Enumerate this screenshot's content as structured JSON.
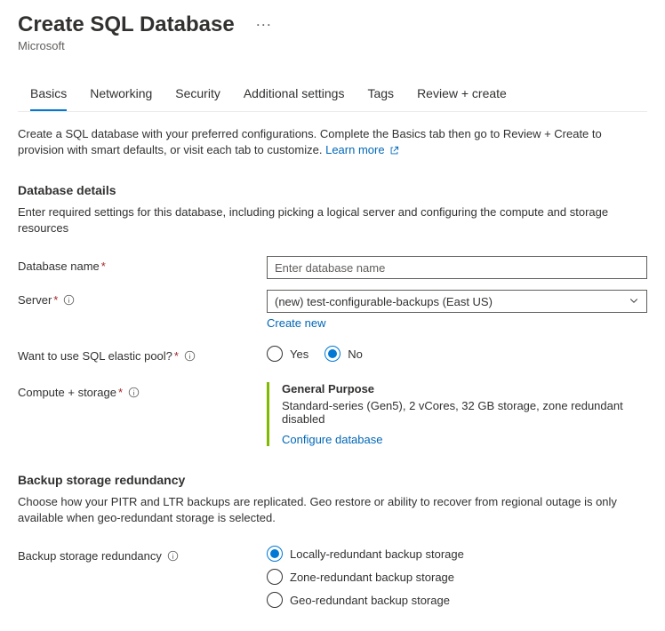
{
  "header": {
    "title": "Create SQL Database",
    "subtitle": "Microsoft"
  },
  "tabs": {
    "items": [
      {
        "label": "Basics",
        "active": true
      },
      {
        "label": "Networking",
        "active": false
      },
      {
        "label": "Security",
        "active": false
      },
      {
        "label": "Additional settings",
        "active": false
      },
      {
        "label": "Tags",
        "active": false
      },
      {
        "label": "Review + create",
        "active": false
      }
    ]
  },
  "intro": {
    "text": "Create a SQL database with your preferred configurations. Complete the Basics tab then go to Review + Create to provision with smart defaults, or visit each tab to customize. ",
    "learn_more": "Learn more"
  },
  "db_details": {
    "title": "Database details",
    "desc": "Enter required settings for this database, including picking a logical server and configuring the compute and storage resources",
    "name_label": "Database name",
    "name_placeholder": "Enter database name",
    "server_label": "Server",
    "server_value": "(new) test-configurable-backups (East US)",
    "create_new": "Create new",
    "elastic_label": "Want to use SQL elastic pool?",
    "elastic_yes": "Yes",
    "elastic_no": "No",
    "compute_label": "Compute + storage",
    "compute_title": "General Purpose",
    "compute_desc": "Standard-series (Gen5), 2 vCores, 32 GB storage, zone redundant disabled",
    "compute_link": "Configure database"
  },
  "backup": {
    "title": "Backup storage redundancy",
    "desc": "Choose how your PITR and LTR backups are replicated. Geo restore or ability to recover from regional outage is only available when geo-redundant storage is selected.",
    "label": "Backup storage redundancy",
    "options": {
      "locally": "Locally-redundant backup storage",
      "zone": "Zone-redundant backup storage",
      "geo": "Geo-redundant backup storage"
    }
  }
}
